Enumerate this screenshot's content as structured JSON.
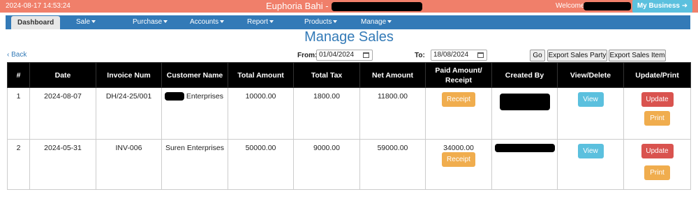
{
  "header": {
    "datetime": "2024-08-17 14:53:24",
    "brand": "Euphoria Bahi -",
    "welcome": "Welcome",
    "my_business": "My Business ➜"
  },
  "nav": {
    "items": [
      {
        "label": "Dashboard"
      },
      {
        "label": "Sale"
      },
      {
        "label": "Purchase"
      },
      {
        "label": "Accounts"
      },
      {
        "label": "Report"
      },
      {
        "label": "Products"
      },
      {
        "label": "Manage"
      }
    ]
  },
  "page": {
    "title": "Manage Sales",
    "back": "‹ Back"
  },
  "filters": {
    "from_label": "From:",
    "from_value": "01/04/2024",
    "to_label": "To:",
    "to_value": "18/08/2024",
    "go": "Go",
    "export_party": "Export Sales Party",
    "export_item": "Export Sales Item"
  },
  "table": {
    "headers": [
      "#",
      "Date",
      "Invoice Num",
      "Customer Name",
      "Total Amount",
      "Total Tax",
      "Net Amount",
      "Paid Amount/ Receipt",
      "Created By",
      "View/Delete",
      "Update/Print"
    ],
    "rows": [
      {
        "num": "1",
        "date": "2024-08-07",
        "invoice": "DH/24-25/001",
        "customer": "Enterprises",
        "total": "10000.00",
        "tax": "1800.00",
        "net": "11800.00",
        "paid": "",
        "receipt": "Receipt",
        "view": "View",
        "update": "Update",
        "print": "Print"
      },
      {
        "num": "2",
        "date": "2024-05-31",
        "invoice": "INV-006",
        "customer": "Suren Enterprises",
        "total": "50000.00",
        "tax": "9000.00",
        "net": "59000.00",
        "paid": "34000.00",
        "receipt": "Receipt",
        "view": "View",
        "update": "Update",
        "print": ""
      }
    ]
  },
  "colors": {
    "topbar": "#f07f6a",
    "navbar": "#337ab7",
    "info": "#5bc0de",
    "warning": "#f0ad4e",
    "danger": "#d9534f"
  }
}
